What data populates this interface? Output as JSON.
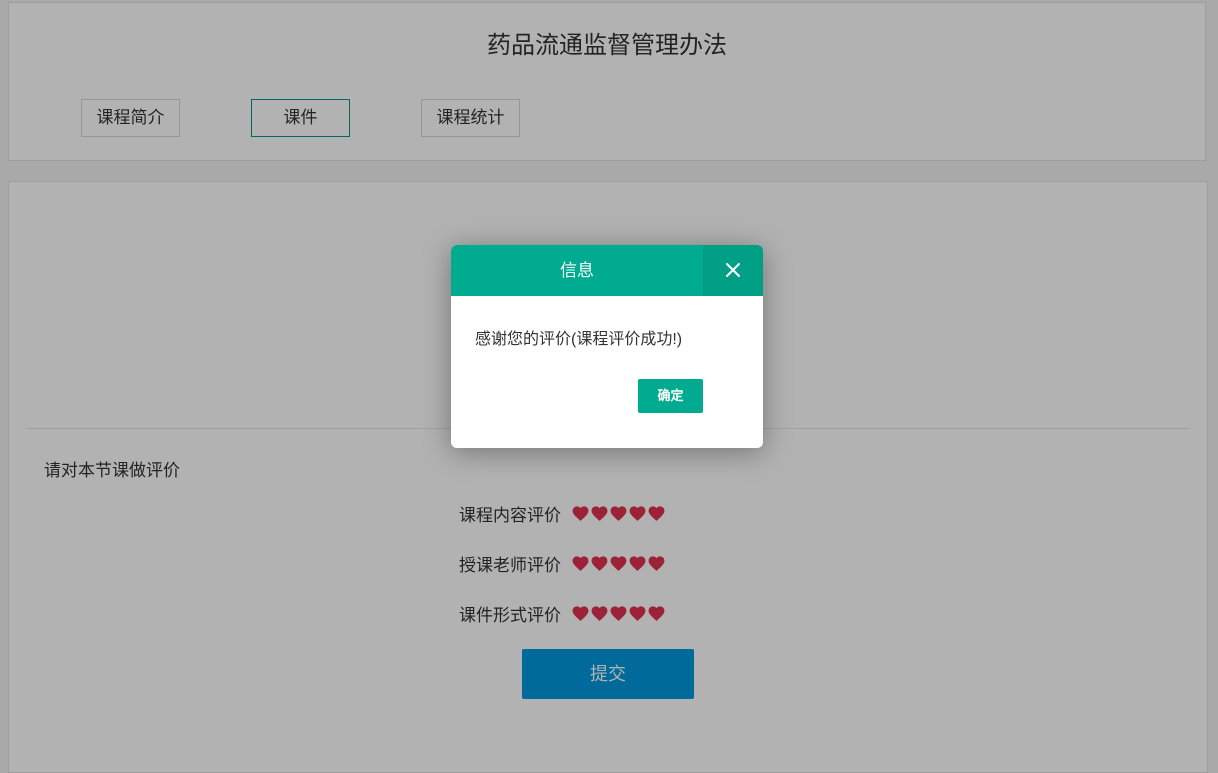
{
  "course": {
    "title": "药品流通监督管理办法"
  },
  "tabs": [
    {
      "label": "课程简介",
      "active": false
    },
    {
      "label": "课件",
      "active": true
    },
    {
      "label": "课程统计",
      "active": false
    }
  ],
  "evaluation": {
    "prompt": "请对本节课做评价",
    "rows": [
      {
        "label": "课程内容评价",
        "rating": 5,
        "max": 5
      },
      {
        "label": "授课老师评价",
        "rating": 5,
        "max": 5
      },
      {
        "label": "课件形式评价",
        "rating": 5,
        "max": 5
      }
    ],
    "submit_label": "提交"
  },
  "dialog": {
    "title": "信息",
    "message": "感谢您的评价(课程评价成功!)",
    "confirm_label": "确定",
    "close_icon": "close-icon"
  },
  "colors": {
    "accent": "#00ab90",
    "heart": "#e0314f",
    "submit": "#0099dd",
    "active_tab_border": "#009688"
  }
}
